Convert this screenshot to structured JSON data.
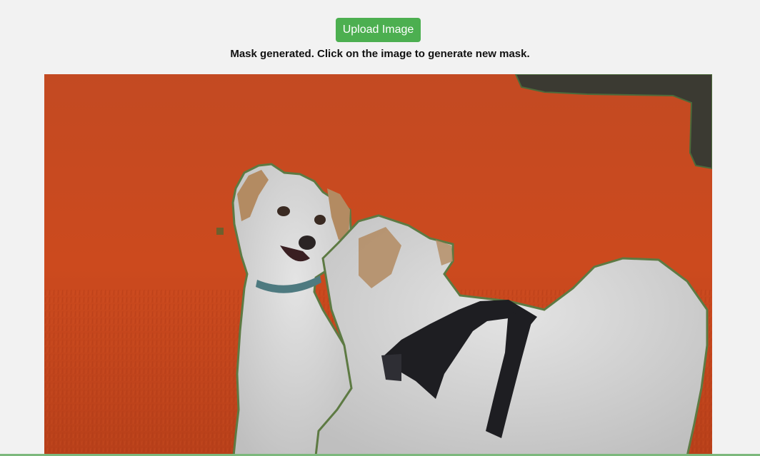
{
  "toolbar": {
    "upload_label": "Upload Image"
  },
  "status": {
    "message": "Mask generated. Click on the image to generate new mask."
  },
  "image": {
    "mask_color": "#c9441f",
    "subject": "two dogs"
  },
  "colors": {
    "accent": "#4caf50",
    "background": "#f2f2f2"
  }
}
